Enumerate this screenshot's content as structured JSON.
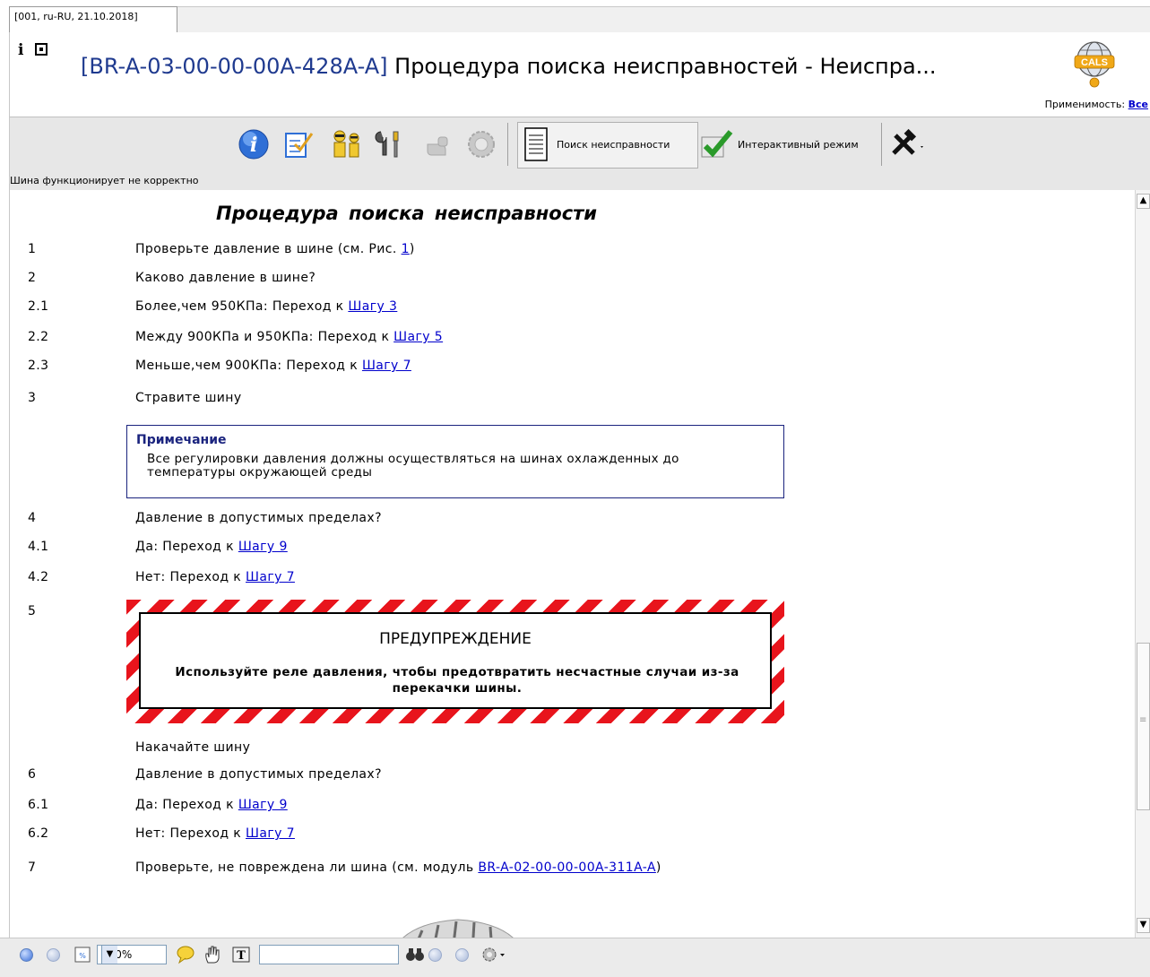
{
  "tab": {
    "label": "[001, ru-RU, 21.10.2018]"
  },
  "header": {
    "title_code": "[BR-A-03-00-00-00A-428A-A]",
    "title_text": " Процедура поиска неисправностей - Неиспра...",
    "applicability_label": "Применимость:",
    "applicability_value": "Все"
  },
  "toolbar": {
    "fault_search_label": "Поиск неисправности",
    "interactive_label": "Интерактивный режим"
  },
  "status": {
    "subtitle": "Шина функционирует не корректно"
  },
  "procedure": {
    "title": "Процедура поиска неисправности",
    "steps": [
      {
        "num": "1",
        "pre": "Проверьте давление в шине (см. Рис. ",
        "link": "1",
        "post": ")"
      },
      {
        "num": "2",
        "pre": "Каково давление в шине?",
        "link": "",
        "post": ""
      },
      {
        "num": "2.1",
        "pre": "Более,чем 950КПа: Переход к ",
        "link": "Шагу 3",
        "post": ""
      },
      {
        "num": "2.2",
        "pre": "Между 900КПа и 950КПа: Переход к ",
        "link": "Шагу 5",
        "post": ""
      },
      {
        "num": "2.3",
        "pre": "Меньше,чем 900КПа: Переход к ",
        "link": "Шагу 7",
        "post": ""
      },
      {
        "num": "3",
        "pre": "Стравите шину",
        "link": "",
        "post": ""
      },
      {
        "num": "4",
        "pre": "Давление в допустимых пределах?",
        "link": "",
        "post": ""
      },
      {
        "num": "4.1",
        "pre": "Да: Переход к ",
        "link": "Шагу 9",
        "post": ""
      },
      {
        "num": "4.2",
        "pre": "Нет: Переход к ",
        "link": "Шагу 7",
        "post": ""
      },
      {
        "num": "5",
        "pre": "",
        "link": "",
        "post": ""
      },
      {
        "num": "",
        "pre": "Накачайте шину",
        "link": "",
        "post": ""
      },
      {
        "num": "6",
        "pre": "Давление в допустимых пределах?",
        "link": "",
        "post": ""
      },
      {
        "num": "6.1",
        "pre": "Да: Переход к ",
        "link": "Шагу 9",
        "post": ""
      },
      {
        "num": "6.2",
        "pre": "Нет: Переход к ",
        "link": "Шагу 7",
        "post": ""
      },
      {
        "num": "7",
        "pre": "Проверьте, не повреждена ли шина (см. модуль  ",
        "link": "BR-A-02-00-00-00A-311A-A",
        "post": ")"
      }
    ],
    "note": {
      "title": "Примечание",
      "text": "Все регулировки давления должны осуществляться на шинах охлажденных до температуры окружающей среды"
    },
    "warning": {
      "title": "ПРЕДУПРЕЖДЕНИЕ",
      "text": "Используйте реле давления, чтобы предотвратить несчастные случаи из-за перекачки шины."
    }
  },
  "bottombar": {
    "zoom_value": "100%",
    "find_value": ""
  },
  "colors": {
    "title_code": "#1f3a8f",
    "link": "#0000cc",
    "note_border": "#1a237e",
    "warning_stripe": "#e8141c",
    "toolbar_bg": "#e7e7e7"
  }
}
